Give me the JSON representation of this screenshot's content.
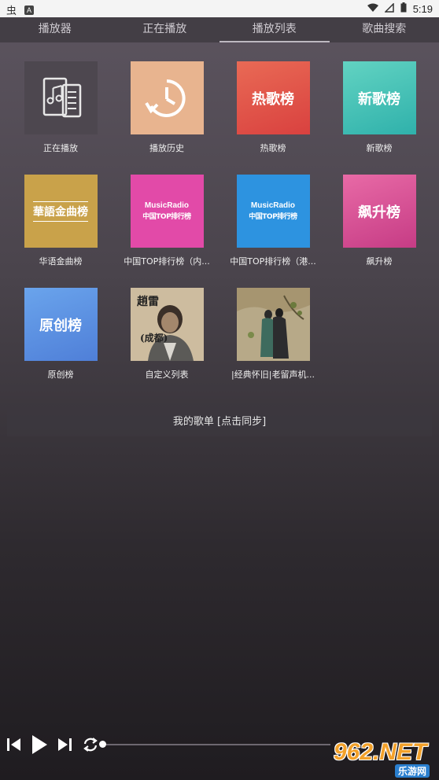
{
  "status_bar": {
    "left_glyph": "虫",
    "badge": "A",
    "time": "5:19"
  },
  "tabs": [
    {
      "label": "播放器"
    },
    {
      "label": "正在播放"
    },
    {
      "label": "播放列表",
      "active": true
    },
    {
      "label": "歌曲搜索"
    }
  ],
  "playlists": [
    {
      "title": "正在播放",
      "thumb_text": "",
      "icon": "music-note-doc-icon",
      "color": "#4d474f"
    },
    {
      "title": "播放历史",
      "thumb_text": "",
      "icon": "history-clock-icon",
      "color": "#e8b48f"
    },
    {
      "title": "热歌榜",
      "thumb_text": "热歌榜",
      "color": "#e35a4d"
    },
    {
      "title": "新歌榜",
      "thumb_text": "新歌榜",
      "color": "#45c5b8"
    },
    {
      "title": "华语金曲榜",
      "thumb_text": "華語金曲榜",
      "color": "#c9a24a"
    },
    {
      "title": "中国TOP排行榜（内...",
      "thumb_text": "中国TOP排行榜",
      "brand": "MusicRadio",
      "color": "#e24aa8"
    },
    {
      "title": "中国TOP排行榜（港...",
      "thumb_text": "中国TOP排行榜",
      "brand": "MusicRadio",
      "color": "#2d93e0"
    },
    {
      "title": "飙升榜",
      "thumb_text": "飙升榜",
      "color": "#d6498f"
    },
    {
      "title": "原创榜",
      "thumb_text": "原创榜",
      "color": "#5a8fe0"
    },
    {
      "title": "自定义列表",
      "thumb_text": "",
      "icon": "artist-photo",
      "color": "#c9b79a"
    },
    {
      "title": "|经典怀旧|老留声机...",
      "thumb_text": "",
      "icon": "painting-art",
      "color": "#9c8e6f"
    }
  ],
  "my_playlist_label": "我的歌单 [点击同步]",
  "watermark": {
    "main": "962.NET",
    "sub": "乐游网"
  }
}
